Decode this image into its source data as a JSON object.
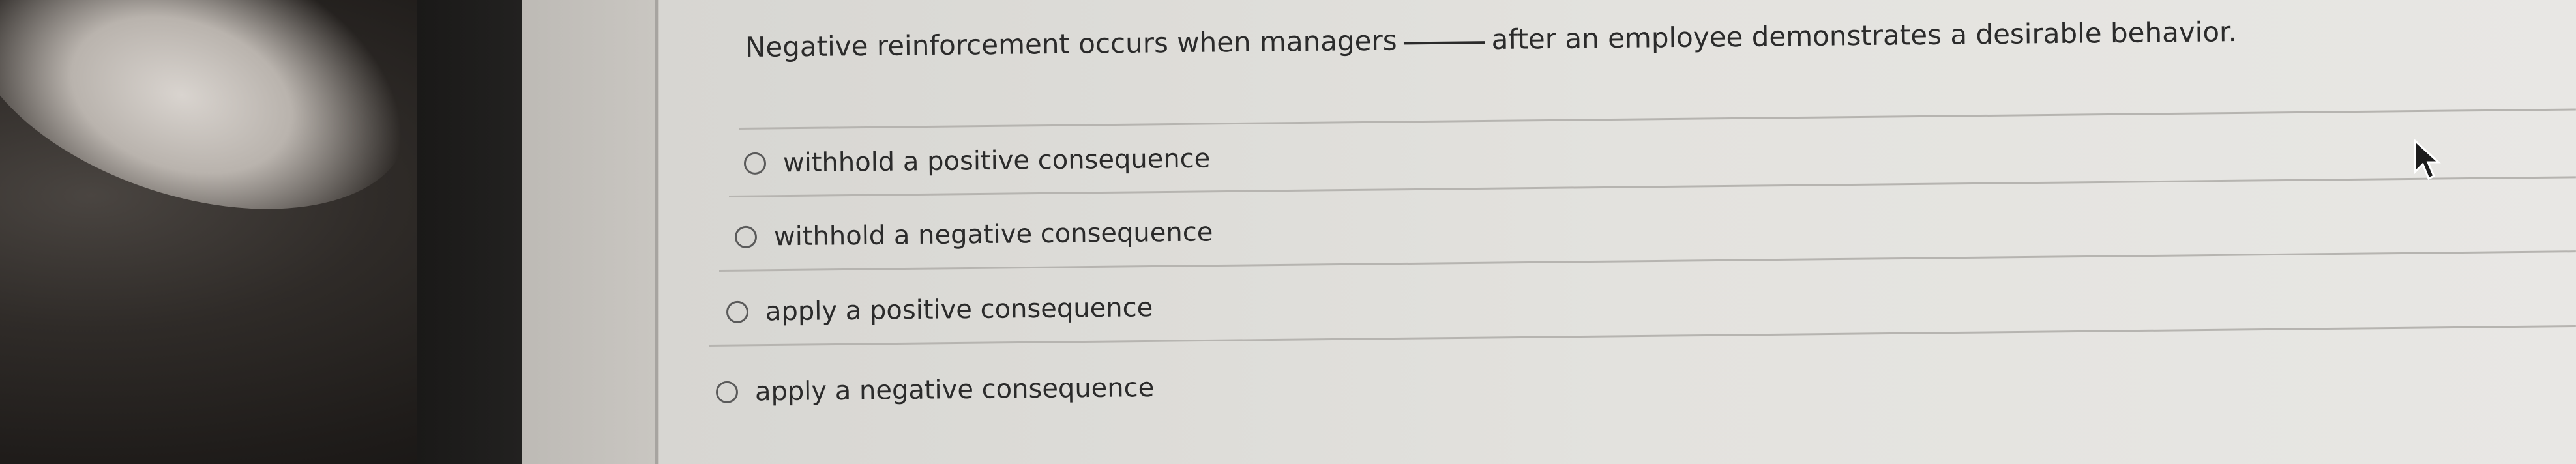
{
  "question": {
    "text_before": "Negative reinforcement occurs when managers",
    "text_after": "after an employee demonstrates a desirable behavior."
  },
  "options": [
    {
      "label": "withhold a positive consequence",
      "selected": false
    },
    {
      "label": "withhold a negative consequence",
      "selected": false
    },
    {
      "label": "apply a positive consequence",
      "selected": false
    },
    {
      "label": "apply a negative consequence",
      "selected": false
    }
  ],
  "colors": {
    "text": "#2b2b2b",
    "radio_border": "#5a5a5a",
    "divider": "#b6b4b0"
  },
  "icons": {
    "cursor": "pointer-arrow-icon",
    "radio": "radio-button-icon"
  }
}
